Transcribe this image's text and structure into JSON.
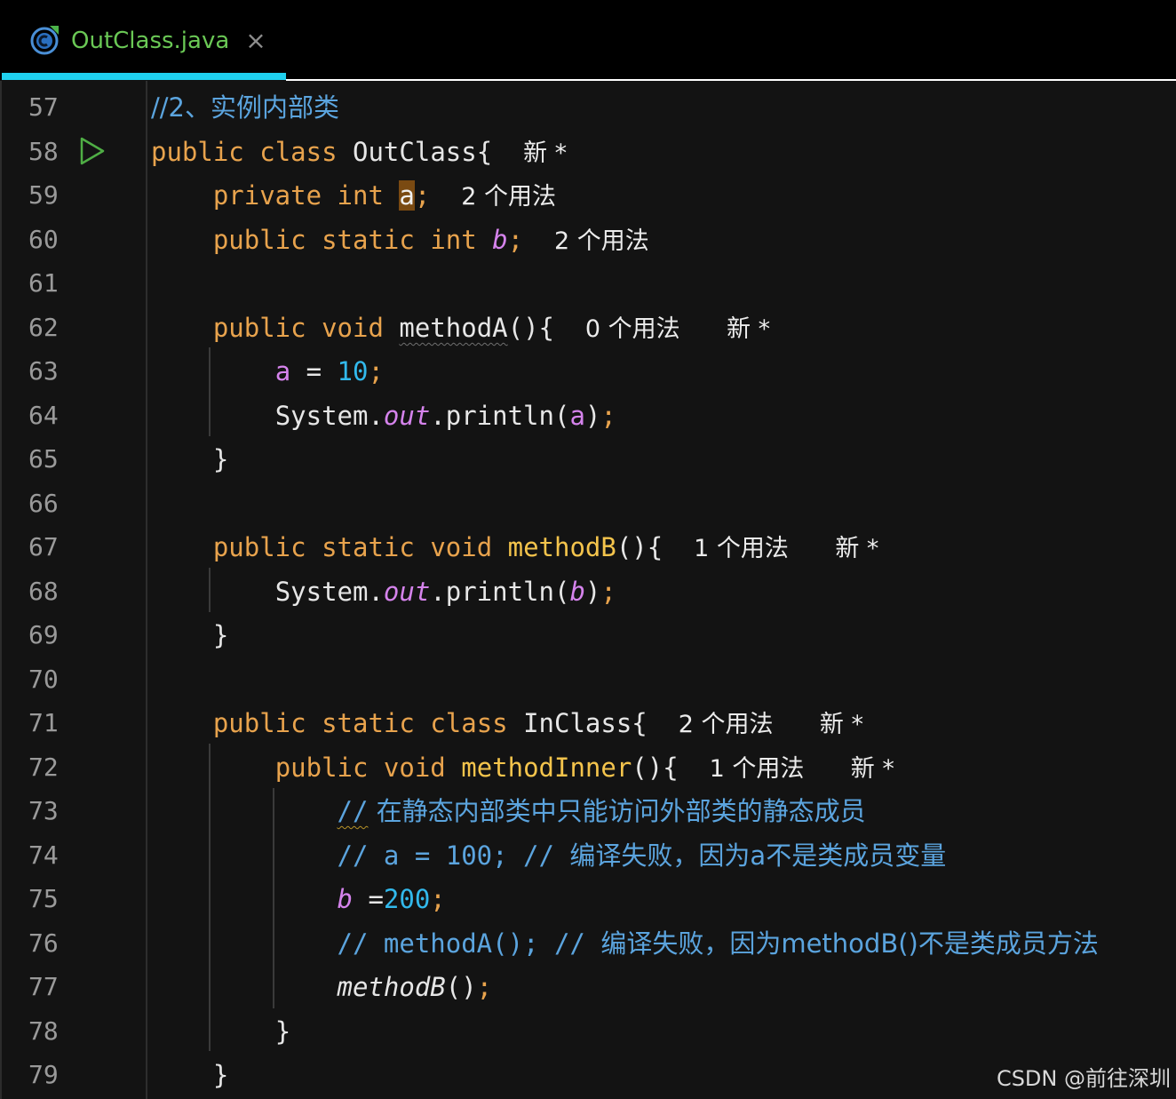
{
  "tab": {
    "title": "OutClass.java",
    "close_glyph": "×",
    "icon": "java-class-icon"
  },
  "colors": {
    "keyword": "#e8a34d",
    "field": "#d583ec",
    "number": "#32b9ec",
    "method": "#f4c44c",
    "comment": "#5ba4de",
    "tab_active_underline": "#1fd0ee",
    "tab_title": "#6ac855"
  },
  "editor": {
    "line_numbers": [
      "57",
      "58",
      "59",
      "60",
      "61",
      "62",
      "63",
      "64",
      "65",
      "66",
      "67",
      "68",
      "69",
      "70",
      "71",
      "72",
      "73",
      "74",
      "75",
      "76",
      "77",
      "78",
      "79"
    ],
    "run_gutter_line": "58",
    "code": {
      "l57": {
        "comment": "//2、实例内部类"
      },
      "l58": {
        "kw1": "public",
        "kw2": "class",
        "name": "OutClass{",
        "hint": "新 *"
      },
      "l59": {
        "kw1": "private",
        "kw2": "int",
        "var": "a",
        "semi": ";",
        "hint": "2 个用法"
      },
      "l60": {
        "kw1": "public",
        "kw2": "static",
        "kw3": "int",
        "var": "b",
        "semi": ";",
        "hint": "2 个用法"
      },
      "l62": {
        "kw1": "public",
        "kw2": "void",
        "name": "methodA",
        "rest": "(){",
        "hint1": "0 个用法",
        "hint2": "新 *"
      },
      "l63": {
        "var": "a",
        "op": " = ",
        "num": "10",
        "semi": ";"
      },
      "l64": {
        "cls": "System.",
        "out": "out",
        "call": ".println(",
        "arg": "a",
        "close": ")",
        "semi": ";"
      },
      "l65": {
        "brace": "}"
      },
      "l67": {
        "kw1": "public",
        "kw2": "static",
        "kw3": "void",
        "name": "methodB",
        "rest": "(){",
        "hint1": "1 个用法",
        "hint2": "新 *"
      },
      "l68": {
        "cls": "System.",
        "out": "out",
        "call": ".println(",
        "arg": "b",
        "close": ")",
        "semi": ";"
      },
      "l69": {
        "brace": "}"
      },
      "l71": {
        "kw1": "public",
        "kw2": "static",
        "kw3": "class",
        "name": "InClass{",
        "hint1": "2 个用法",
        "hint2": "新 *"
      },
      "l72": {
        "kw1": "public",
        "kw2": "void",
        "name": "methodInner",
        "rest": "(){",
        "hint1": "1 个用法",
        "hint2": "新 *"
      },
      "l73": {
        "slashes": "//",
        "comment": " 在静态内部类中只能访问外部类的静态成员"
      },
      "l74": {
        "code": "// a = 100; // ",
        "comment_cn": "编译失败，因为a不是类成员变量"
      },
      "l75": {
        "var": "b",
        "op": " =",
        "num": "200",
        "semi": ";"
      },
      "l76": {
        "code": "// methodA(); // ",
        "comment_cn": "编译失败，因为methodB()不是类成员方法"
      },
      "l77": {
        "call": "methodB",
        "rest": "()",
        "semi": ";"
      },
      "l78": {
        "brace": "}"
      },
      "l79": {
        "brace": "}"
      }
    }
  },
  "watermark": "CSDN @前往深圳"
}
